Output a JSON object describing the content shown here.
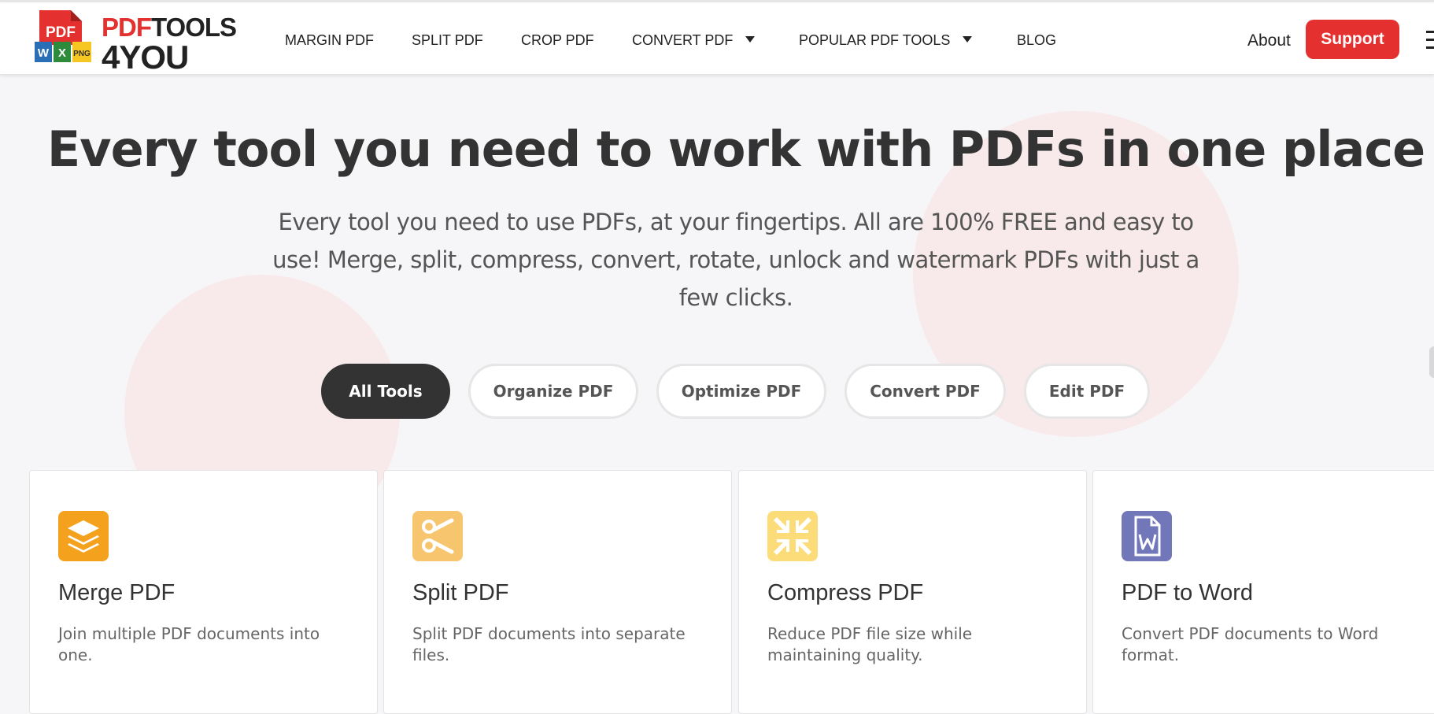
{
  "logo": {
    "badge": "PDF",
    "mini_w": "W",
    "mini_x": "X",
    "mini_png": "PNG",
    "line1_red": "PDF",
    "line1_dark": "TOOLS",
    "line2": "4YOU"
  },
  "nav": {
    "items": [
      {
        "label": "MARGIN PDF"
      },
      {
        "label": "SPLIT PDF"
      },
      {
        "label": "CROP PDF"
      },
      {
        "label": "CONVERT PDF"
      },
      {
        "label": "POPULAR PDF TOOLS"
      },
      {
        "label": "BLOG"
      }
    ],
    "about": "About",
    "support": "Support"
  },
  "hero": {
    "title": "Every tool you need to work with PDFs in one place",
    "subtitle": "Every tool you need to use PDFs, at your fingertips. All are 100% FREE and easy to use! Merge, split, compress, convert, rotate, unlock and watermark PDFs with just a few clicks."
  },
  "filters": [
    {
      "label": "All Tools",
      "active": true
    },
    {
      "label": "Organize PDF"
    },
    {
      "label": "Optimize PDF"
    },
    {
      "label": "Convert PDF"
    },
    {
      "label": "Edit PDF"
    }
  ],
  "cards": [
    {
      "title": "Merge PDF",
      "desc": "Join multiple PDF documents into one.",
      "icon": "layers-icon",
      "color": "#f4a11d"
    },
    {
      "title": "Split PDF",
      "desc": "Split PDF documents into separate files.",
      "icon": "scissors-icon",
      "color": "#f8c56f"
    },
    {
      "title": "Compress PDF",
      "desc": "Reduce PDF file size while maintaining quality.",
      "icon": "compress-icon",
      "color": "#fbdc78"
    },
    {
      "title": "PDF to Word",
      "desc": "Convert PDF documents to Word format.",
      "icon": "word-document-icon",
      "color": "#7277b9"
    }
  ],
  "colors": {
    "brand_red": "#e4312f",
    "active_pill": "#333333",
    "decor_circle": "#f8e9ea"
  }
}
